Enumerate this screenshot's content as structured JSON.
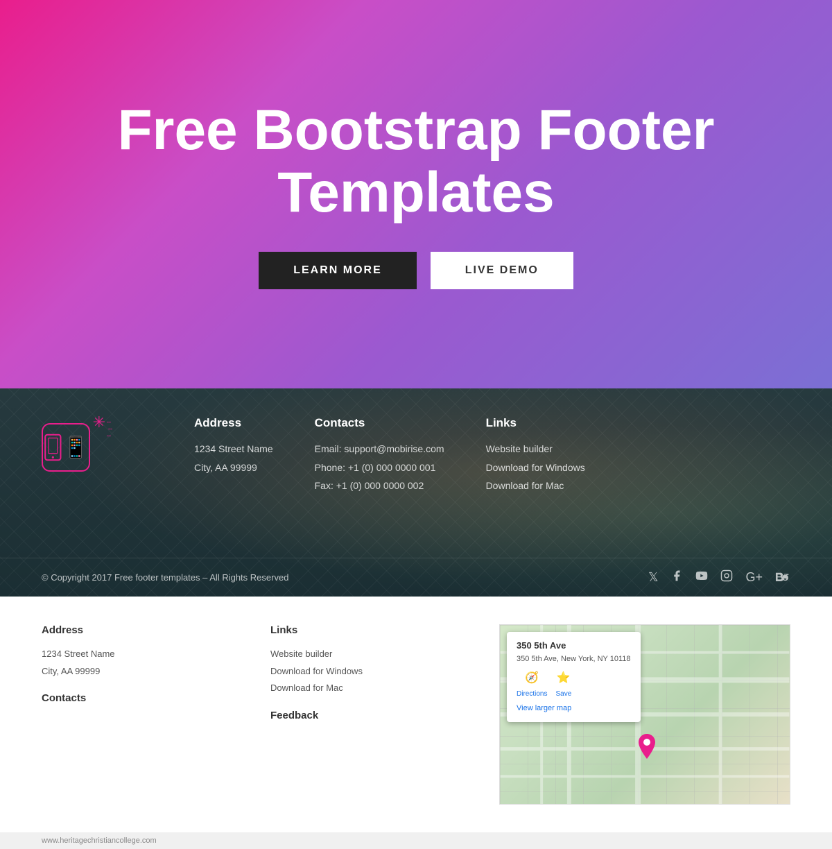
{
  "hero": {
    "title": "Free Bootstrap Footer Templates",
    "learn_more_label": "LEARN MORE",
    "live_demo_label": "LIVE DEMO"
  },
  "footer_dark": {
    "address": {
      "heading": "Address",
      "line1": "1234 Street Name",
      "line2": "City, AA 99999"
    },
    "contacts": {
      "heading": "Contacts",
      "email": "Email: support@mobirise.com",
      "phone": "Phone: +1 (0) 000 0000 001",
      "fax": "Fax: +1 (0) 000 0000 002"
    },
    "links": {
      "heading": "Links",
      "items": [
        "Website builder",
        "Download for Windows",
        "Download for Mac"
      ]
    },
    "copyright": "© Copyright 2017 Free footer templates – All Rights Reserved",
    "social_icons": [
      "twitter",
      "facebook",
      "youtube",
      "instagram",
      "google-plus",
      "behance"
    ]
  },
  "footer_light": {
    "address": {
      "heading": "Address",
      "line1": "1234 Street Name",
      "line2": "City, AA 99999"
    },
    "links": {
      "heading": "Links",
      "items": [
        "Website builder",
        "Download for Windows",
        "Download for Mac"
      ]
    },
    "contacts_heading": "Contacts",
    "feedback_heading": "Feedback",
    "map": {
      "popup_title": "350 5th Ave",
      "popup_subtitle": "350 5th Ave, New York, NY 10118",
      "view_larger": "View larger map",
      "directions": "Directions",
      "save": "Save"
    }
  },
  "site_url": "www.heritagechristiancollege.com"
}
